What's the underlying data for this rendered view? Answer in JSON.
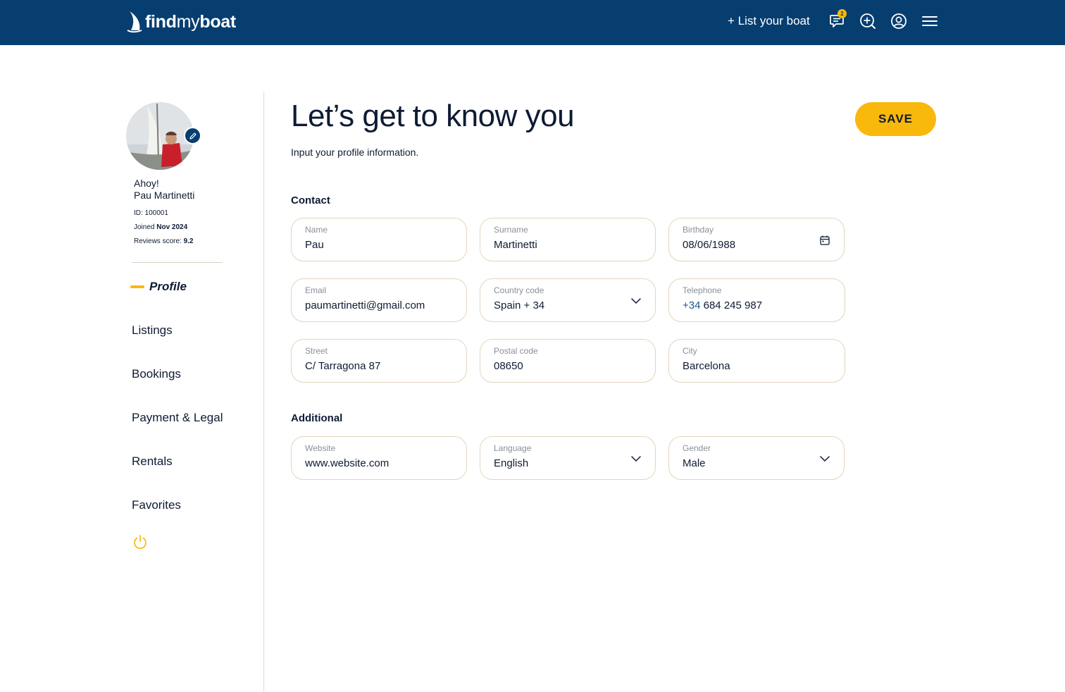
{
  "header": {
    "logo_bold": "find",
    "logo_light": "my",
    "logo_bold2": "boat",
    "list_boat": "+ List your boat",
    "notifications_count": "2",
    "icons": [
      "chat-icon",
      "search-plus-icon",
      "user-icon",
      "menu-icon"
    ]
  },
  "profile": {
    "greeting": "Ahoy!",
    "name": "Pau Martinetti",
    "id_label": "ID:",
    "id_value": "100001",
    "joined_label": "Joined",
    "joined_value": "Nov 2024",
    "reviews_label": "Reviews score:",
    "reviews_value": "9.2"
  },
  "nav": {
    "items": [
      {
        "label": "Profile",
        "active": true
      },
      {
        "label": "Listings"
      },
      {
        "label": "Bookings"
      },
      {
        "label": "Payment & Legal"
      },
      {
        "label": "Rentals"
      },
      {
        "label": "Favorites"
      }
    ]
  },
  "main": {
    "title": "Let’s get to know you",
    "subtitle": "Input your profile information.",
    "save_label": "SAVE",
    "contact_heading": "Contact",
    "additional_heading": "Additional",
    "fields": {
      "name": {
        "label": "Name",
        "value": "Pau"
      },
      "surname": {
        "label": "Surname",
        "value": "Martinetti"
      },
      "birthday": {
        "label": "Birthday",
        "value": "08/06/1988"
      },
      "email": {
        "label": "Email",
        "value": "paumartinetti@gmail.com"
      },
      "country_code": {
        "label": "Country code",
        "value": "Spain + 34"
      },
      "telephone": {
        "label": "Telephone",
        "prefix": "+34",
        "value": "684 245 987"
      },
      "street": {
        "label": "Street",
        "value": "C/ Tarragona 87"
      },
      "postal_code": {
        "label": "Postal code",
        "value": "08650"
      },
      "city": {
        "label": "City",
        "value": "Barcelona"
      },
      "website": {
        "label": "Website",
        "value": "www.website.com"
      },
      "language": {
        "label": "Language",
        "value": "English"
      },
      "gender": {
        "label": "Gender",
        "value": "Male"
      }
    }
  },
  "colors": {
    "header_bg": "#063e70",
    "accent": "#f9b80c",
    "text": "#0e1b33",
    "field_border": "#e2d6bd"
  }
}
